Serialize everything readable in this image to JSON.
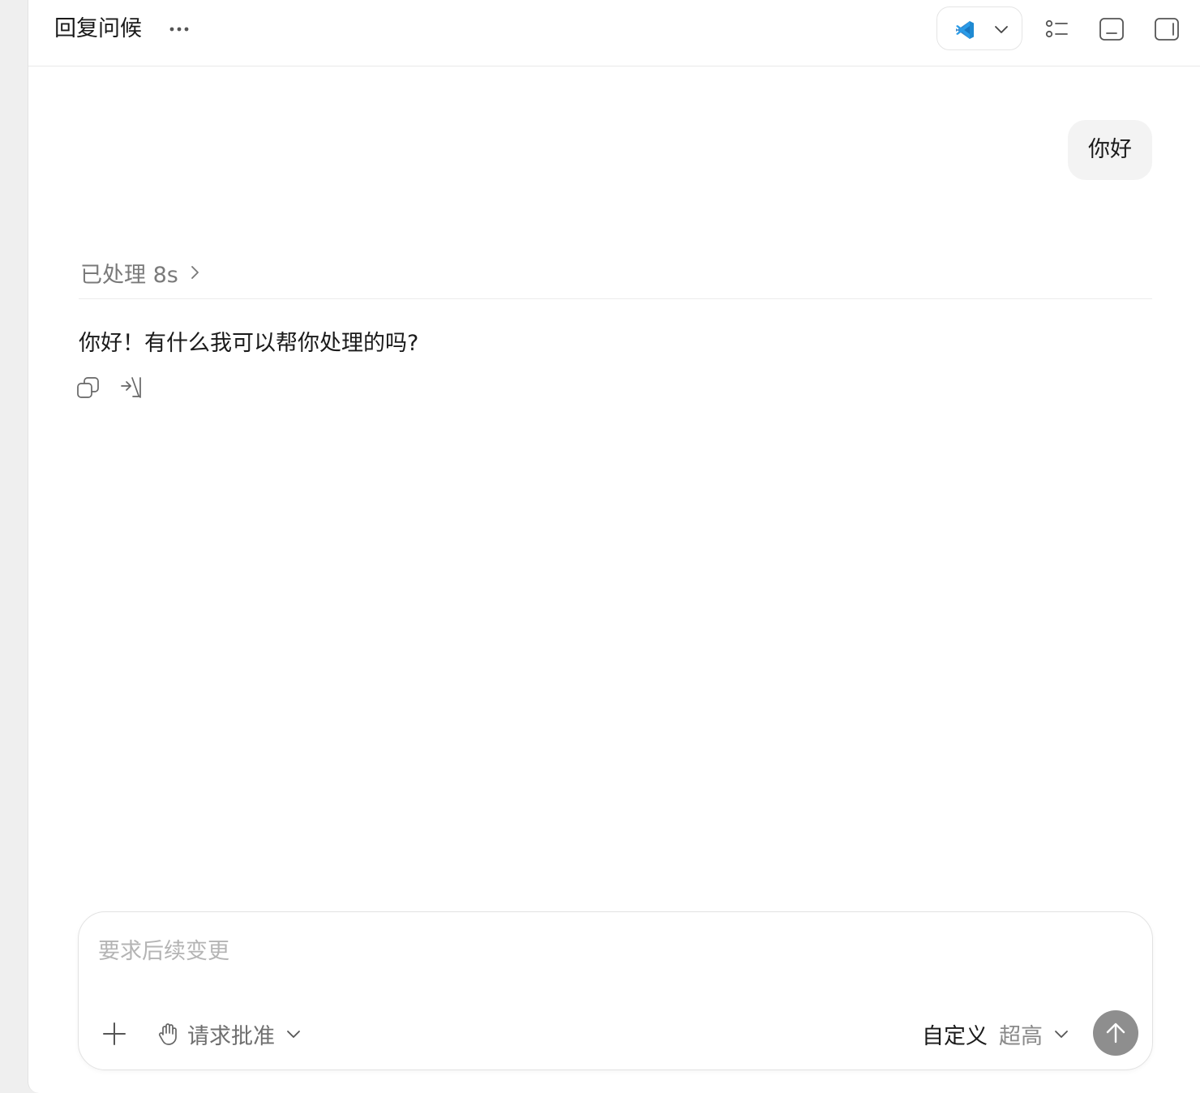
{
  "header": {
    "title": "回复问候",
    "editor_icon": "vscode-icon"
  },
  "chat": {
    "user_message": "你好",
    "processed_label": "已处理 8s",
    "assistant_message": "你好！有什么我可以帮你处理的吗?"
  },
  "composer": {
    "placeholder": "要求后续变更",
    "approval_label": "请求批准",
    "model_name": "自定义",
    "model_level": "超高"
  },
  "colors": {
    "accent_vscode": "#1f8ad2",
    "send_button": "#8e8e8e",
    "muted_text": "#7a7a7a"
  }
}
